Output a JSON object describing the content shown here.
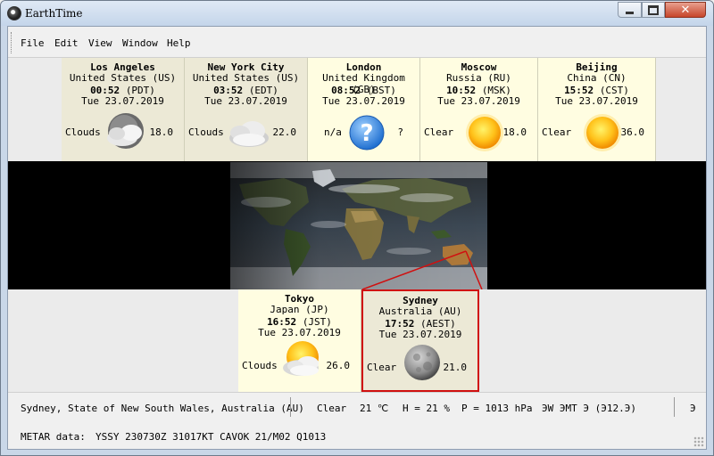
{
  "window": {
    "title": "EarthTime"
  },
  "menu": [
    "File",
    "Edit",
    "View",
    "Window",
    "Help"
  ],
  "cities": [
    {
      "city": "Los Angeles",
      "country": "United States (US)",
      "time": "00:52",
      "tz": "(PDT)",
      "date": "Tue 23.07.2019",
      "condition": "Clouds",
      "temp": "18.0",
      "icon": "night-cloud-icon"
    },
    {
      "city": "New York City",
      "country": "United States (US)",
      "time": "03:52",
      "tz": "(EDT)",
      "date": "Tue 23.07.2019",
      "condition": "Clouds",
      "temp": "22.0",
      "icon": "cloud-icon"
    },
    {
      "city": "London",
      "country": "United Kingdom (GB)",
      "time": "08:52",
      "tz": "(BST)",
      "date": "Tue 23.07.2019",
      "condition": "n/a",
      "temp": "?",
      "icon": "question-icon"
    },
    {
      "city": "Moscow",
      "country": "Russia (RU)",
      "time": "10:52",
      "tz": "(MSK)",
      "date": "Tue 23.07.2019",
      "condition": "Clear",
      "temp": "18.0",
      "icon": "sun-icon"
    },
    {
      "city": "Beijing",
      "country": "China (CN)",
      "time": "15:52",
      "tz": "(CST)",
      "date": "Tue 23.07.2019",
      "condition": "Clear",
      "temp": "36.0",
      "icon": "sun-icon"
    },
    {
      "city": "Tokyo",
      "country": "Japan (JP)",
      "time": "16:52",
      "tz": "(JST)",
      "date": "Tue 23.07.2019",
      "condition": "Clouds",
      "temp": "26.0",
      "icon": "sun-cloud-icon"
    },
    {
      "city": "Sydney",
      "country": "Australia (AU)",
      "time": "17:52",
      "tz": "(AEST)",
      "date": "Tue 23.07.2019",
      "condition": "Clear",
      "temp": "21.0",
      "icon": "moon-icon"
    }
  ],
  "status": {
    "location": "Sydney, State of New South Wales, Australia (AU)",
    "condition": "Clear",
    "temp": "21 ℃",
    "humidity": "H = 21 %",
    "pressure": "P = 1013 hPa",
    "extra": "ЭW   ЭМТ   Э   (Э12.Э)"
  },
  "metar": {
    "label": "METAR data:",
    "value": "YSSY 230730Z 31017KT CAVOK 21/M02 Q1013"
  },
  "colors": {
    "card": "#fffde1",
    "card_dim": "#ece9d6",
    "selection": "#d01010"
  }
}
